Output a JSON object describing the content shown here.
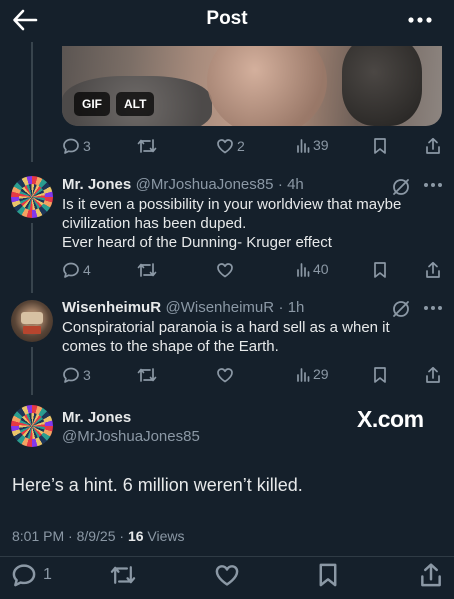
{
  "header": {
    "title": "Post",
    "back_icon": "arrow-left-icon",
    "more_icon": "more-dots-icon"
  },
  "media": {
    "badges": [
      "GIF",
      "ALT"
    ]
  },
  "media_actions": {
    "replies": "3",
    "reposts": "",
    "likes": "2",
    "views": "39"
  },
  "replies": [
    {
      "name": "Mr. Jones",
      "handle": "@MrJoshuaJones85",
      "time": "· 4h",
      "lines": [
        "Is it even a possibility in your worldview that maybe",
        "civilization has been duped.",
        "Ever heard of the Dunning- Kruger effect"
      ],
      "actions": {
        "replies": "4",
        "reposts": "",
        "likes": "",
        "views": "40"
      }
    },
    {
      "name": "WisenheimuR",
      "handle": "@WisenheimuR",
      "time": "· 1h",
      "lines": [
        "Conspiratorial paranoia is a hard sell as a when it",
        "comes to the shape of the Earth."
      ],
      "actions": {
        "replies": "3",
        "reposts": "",
        "likes": "",
        "views": "29"
      }
    }
  ],
  "main_post": {
    "name": "Mr. Jones",
    "handle": "@MrJoshuaJones85",
    "watermark": "X.com",
    "text": "Here’s a hint. 6 million weren’t killed.",
    "datetime": "8:01 PM · 8/9/25 · ",
    "views_count": "16",
    "views_label": " Views"
  },
  "bottom_actions": {
    "replies": "1"
  },
  "colors": {
    "background": "#15202b",
    "text": "#e7e9ea",
    "muted": "#8b98a5"
  }
}
